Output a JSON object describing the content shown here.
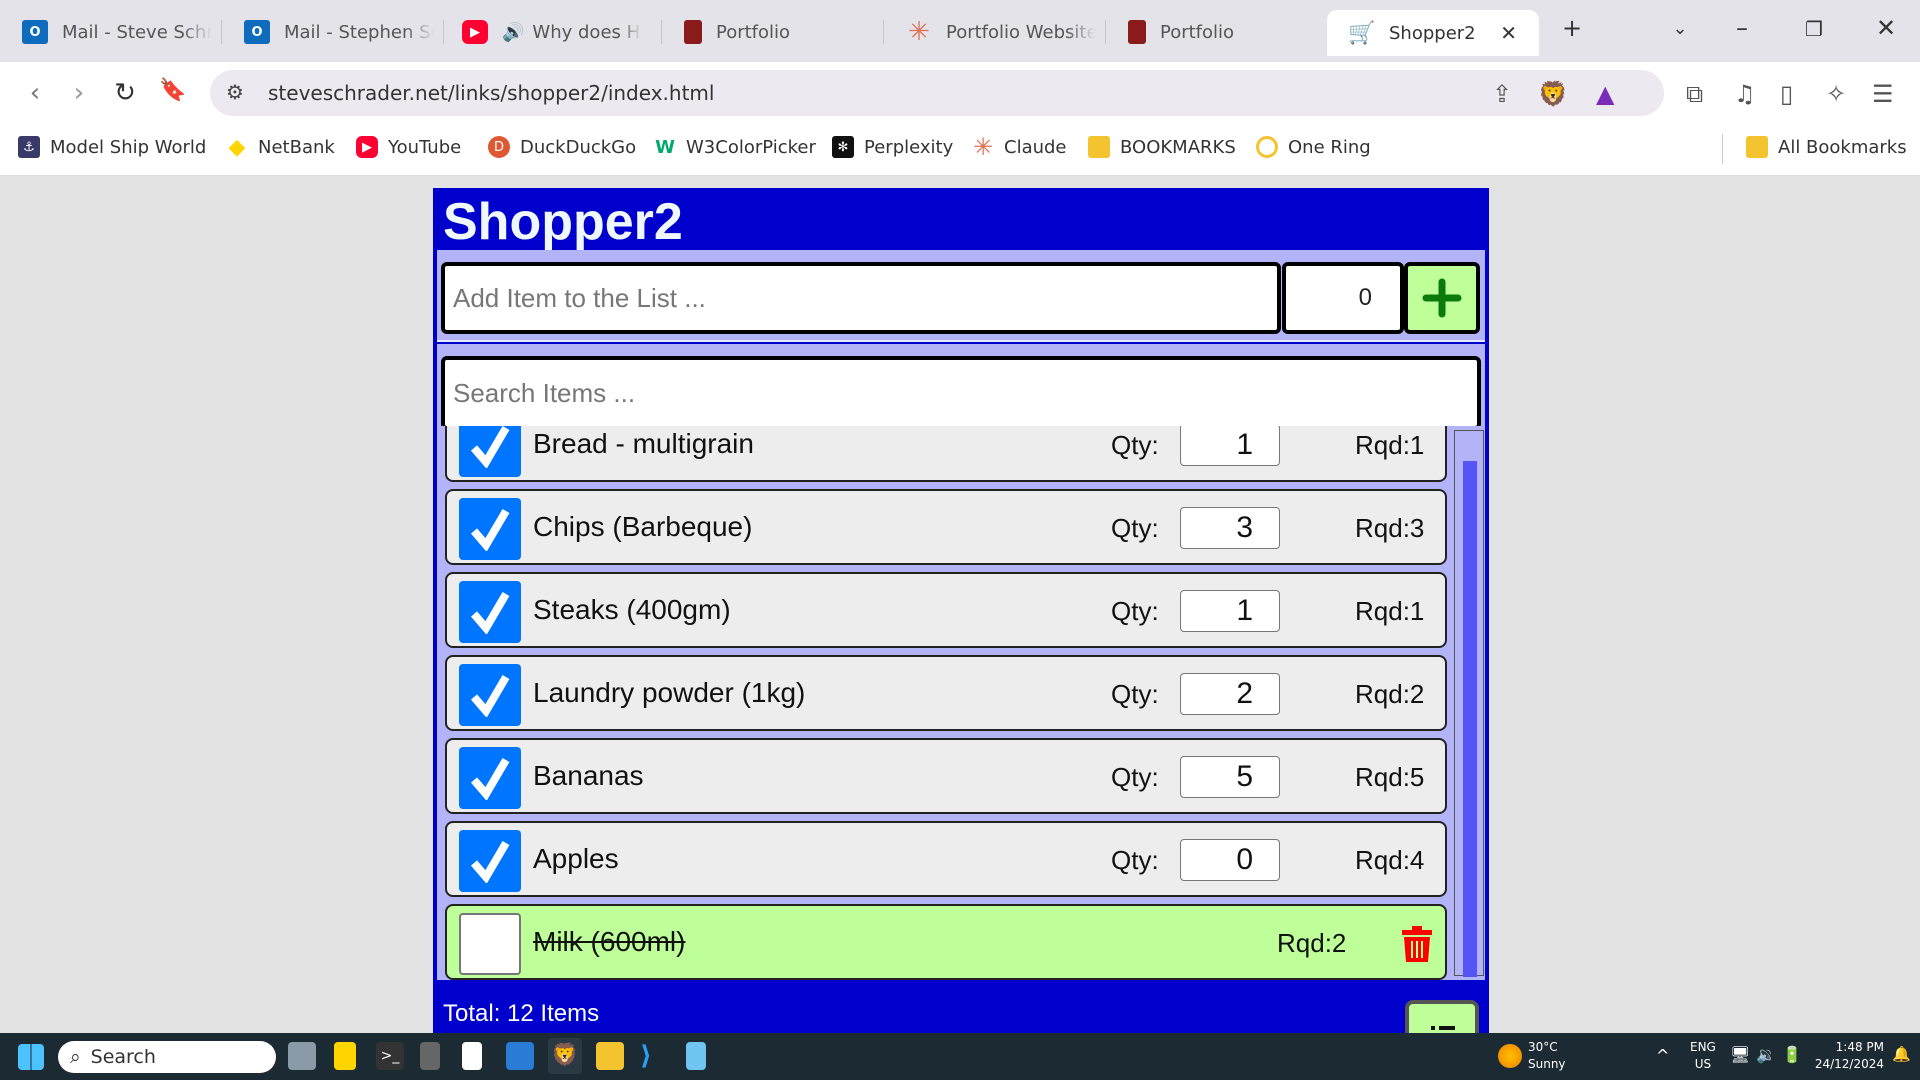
{
  "browser": {
    "tabs": [
      {
        "title": "Mail - Steve Schrader",
        "icon": "outlook-icon",
        "color": "#0f6cbd"
      },
      {
        "title": "Mail - Stephen Schrader",
        "icon": "outlook-icon",
        "color": "#0f6cbd"
      },
      {
        "title": "Why does How",
        "icon": "youtube-icon",
        "color": "#ff0033",
        "audio": "speaker-icon"
      },
      {
        "title": "Portfolio",
        "icon": "portfolio-icon",
        "color": "#8b1a1a"
      },
      {
        "title": "Portfolio Website",
        "icon": "claude-icon",
        "color": "#e07050"
      },
      {
        "title": "Portfolio",
        "icon": "portfolio-icon",
        "color": "#8b1a1a"
      },
      {
        "title": "Shopper2",
        "icon": "shopping-cart-icon",
        "active": true
      }
    ],
    "new_tab": "+",
    "url": "steveschrader.net/links/shopper2/index.html",
    "bookmarks": [
      {
        "label": "Model Ship World",
        "icon": "model-ship-world-icon"
      },
      {
        "label": "NetBank",
        "icon": "netbank-icon"
      },
      {
        "label": "YouTube",
        "icon": "youtube-icon"
      },
      {
        "label": "DuckDuckGo",
        "icon": "duckduckgo-icon"
      },
      {
        "label": "W3ColorPicker",
        "icon": "w3-icon"
      },
      {
        "label": "Perplexity",
        "icon": "perplexity-icon"
      },
      {
        "label": "Claude",
        "icon": "claude-icon"
      },
      {
        "label": "BOOKMARKS",
        "icon": "folder-icon"
      },
      {
        "label": "One Ring",
        "icon": "ring-icon"
      }
    ],
    "all_bookmarks": "All Bookmarks"
  },
  "app": {
    "title": "Shopper2",
    "add_placeholder": "Add Item to the List ...",
    "add_qty": "0",
    "search_placeholder": "Search Items ...",
    "qty_label": "Qty:",
    "items": [
      {
        "name": "Bread - multigrain",
        "qty": "1",
        "rqd": "Rqd:1",
        "checked": true
      },
      {
        "name": "Chips (Barbeque)",
        "qty": "3",
        "rqd": "Rqd:3",
        "checked": true
      },
      {
        "name": "Steaks (400gm)",
        "qty": "1",
        "rqd": "Rqd:1",
        "checked": true
      },
      {
        "name": "Laundry powder (1kg)",
        "qty": "2",
        "rqd": "Rqd:2",
        "checked": true
      },
      {
        "name": "Bananas",
        "qty": "5",
        "rqd": "Rqd:5",
        "checked": true
      },
      {
        "name": "Apples",
        "qty": "0",
        "rqd": "Rqd:4",
        "checked": true
      },
      {
        "name": "Milk (600ml)",
        "rqd": "Rqd:2",
        "checked": false,
        "done": true
      }
    ],
    "total": "Total: 12 Items",
    "colors": {
      "header": "#0000cd",
      "panel": "#b3b3f8",
      "accent_green": "#bfff99",
      "checkbox": "#0075ff",
      "trash": "#ff0000"
    }
  },
  "taskbar": {
    "search": "Search",
    "weather_temp": "30°C",
    "weather_desc": "Sunny",
    "lang1": "ENG",
    "lang2": "US",
    "time": "1:48 PM",
    "date": "24/12/2024"
  }
}
